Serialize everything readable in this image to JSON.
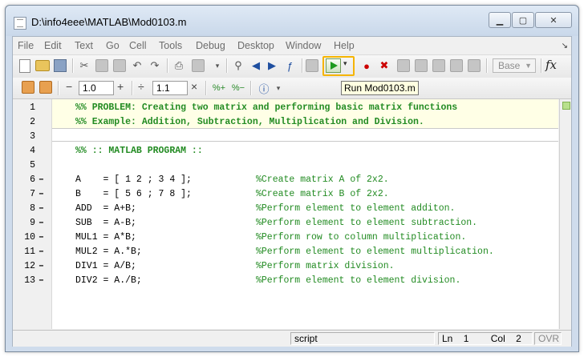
{
  "window": {
    "title": "D:\\info4eee\\MATLAB\\Mod0103.m",
    "minimize_icon": "minimize-icon",
    "maximize_icon": "maximize-icon",
    "close_icon": "close-icon"
  },
  "menu": {
    "items": [
      "File",
      "Edit",
      "Text",
      "Go",
      "Cell",
      "Tools",
      "Debug",
      "Desktop",
      "Window",
      "Help"
    ],
    "corner_glyph": "↘"
  },
  "toolbar": {
    "tooltip": "Run Mod0103.m",
    "base_select": "Base",
    "fx_label": "fx",
    "highlight_color": "#f5b400"
  },
  "cell_toolbar": {
    "minus": "−",
    "plus": "+",
    "divide": "÷",
    "times": "×",
    "step_value": "1.0",
    "scale_value": "1.1"
  },
  "editor": {
    "lines": [
      {
        "num": "1",
        "dash": "",
        "code": "%% PROBLEM: Creating two matrix and performing basic matrix functions",
        "comment": "",
        "cell": true
      },
      {
        "num": "2",
        "dash": "",
        "code": "%% Example: Addition, Subtraction, Multiplication and Division.",
        "comment": "",
        "cell": true
      },
      {
        "num": "3",
        "dash": "",
        "code": "",
        "comment": "",
        "cell": false
      },
      {
        "num": "4",
        "dash": "",
        "code": "%% :: MATLAB PROGRAM ::",
        "comment": "",
        "cell": true
      },
      {
        "num": "5",
        "dash": "",
        "code": "",
        "comment": "",
        "cell": false
      },
      {
        "num": "6",
        "dash": "–",
        "code": "A    = [ 1 2 ; 3 4 ];",
        "comment": "%Create matrix A of 2x2.",
        "cell": false
      },
      {
        "num": "7",
        "dash": "–",
        "code": "B    = [ 5 6 ; 7 8 ];",
        "comment": "%Create matrix B of 2x2.",
        "cell": false
      },
      {
        "num": "8",
        "dash": "–",
        "code": "ADD  = A+B;",
        "comment": "%Perform element to element additon.",
        "cell": false
      },
      {
        "num": "9",
        "dash": "–",
        "code": "SUB  = A-B;",
        "comment": "%Perform element to element subtraction.",
        "cell": false
      },
      {
        "num": "10",
        "dash": "–",
        "code": "MUL1 = A*B;",
        "comment": "%Perform row to column multiplication.",
        "cell": false
      },
      {
        "num": "11",
        "dash": "–",
        "code": "MUL2 = A.*B;",
        "comment": "%Perform element to element multiplication.",
        "cell": false
      },
      {
        "num": "12",
        "dash": "–",
        "code": "DIV1 = A/B;",
        "comment": "%Perform matrix division.",
        "cell": false
      },
      {
        "num": "13",
        "dash": "–",
        "code": "DIV2 = A./B;",
        "comment": "%Perform element to element division.",
        "cell": false
      }
    ]
  },
  "status": {
    "mode": "script",
    "ln_label": "Ln",
    "ln_value": "1",
    "col_label": "Col",
    "col_value": "2",
    "ovr": "OVR"
  }
}
